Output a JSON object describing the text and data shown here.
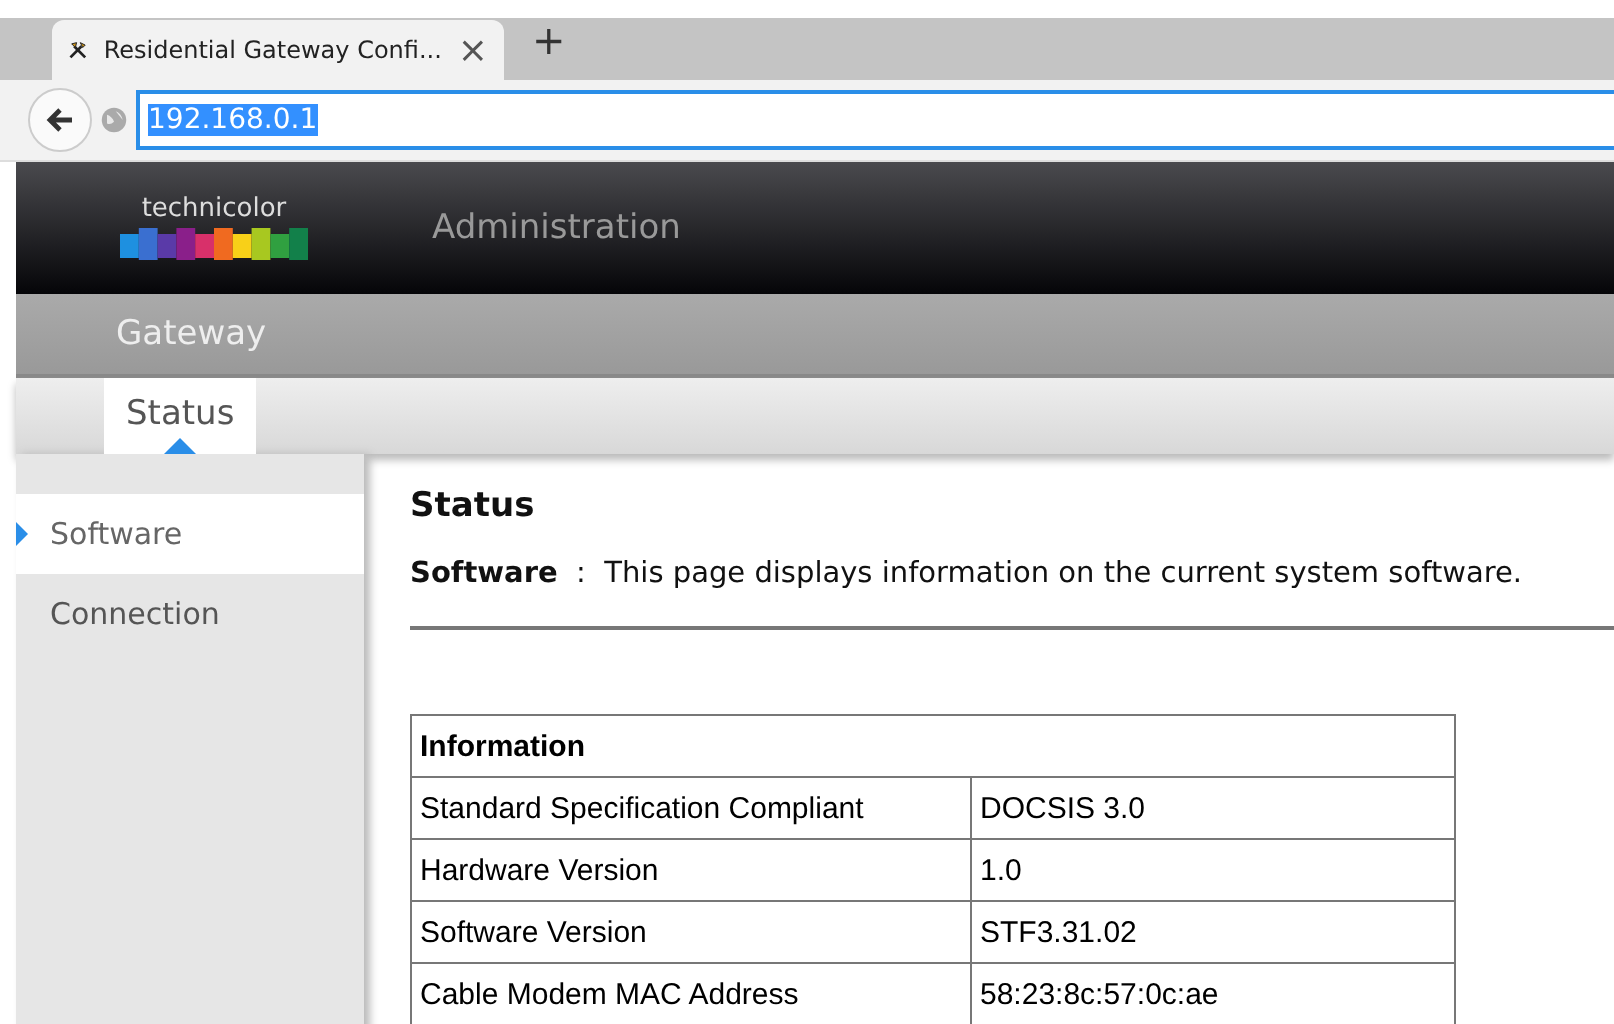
{
  "browser": {
    "tab_title": "Residential Gateway Confi...",
    "close": "×",
    "new_tab": "+",
    "address": "192.168.0.1"
  },
  "header": {
    "logo_text": "technicolor",
    "title": "Administration"
  },
  "nav": {
    "section": "Gateway",
    "tabs": [
      {
        "label": "Status",
        "selected": true
      }
    ]
  },
  "sidebar": {
    "items": [
      {
        "label": "Software",
        "selected": true
      },
      {
        "label": "Connection",
        "selected": false
      }
    ]
  },
  "content": {
    "title": "Status",
    "intro": "**Software**  :  This page displays information on the current system software.",
    "table": {
      "heading": "Information",
      "rows": [
        {
          "label": "Standard Specification Compliant",
          "value": "DOCSIS 3.0"
        },
        {
          "label": "Hardware Version",
          "value": "1.0"
        },
        {
          "label": "Software Version",
          "value": "STF3.31.02"
        },
        {
          "label": "Cable Modem MAC Address",
          "value": "58:23:8c:57:0c:ae"
        }
      ]
    }
  }
}
